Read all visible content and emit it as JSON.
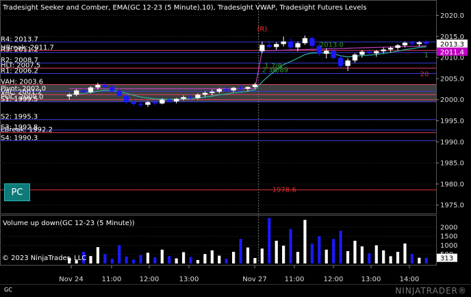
{
  "price_panel": {
    "title": "Tradesight Seeker and Comber, EMA(GC 12-23 (5 Minute),10), Tradesight VWAP, Tradesight Futures Levels",
    "ylim": [
      1973,
      2023
    ],
    "yticks": [
      1975.0,
      1980.0,
      1985.0,
      1990.0,
      1995.0,
      2000.0,
      2005.0,
      2010.0,
      2015.0,
      2020.0
    ],
    "current_price": "2013.3",
    "vwap_value": "2011.4",
    "marker_text": "(R)",
    "annotations": [
      {
        "text": "2013.0",
        "x": 0.73,
        "y": 2013.0,
        "color": "#2e9e2e"
      },
      {
        "text": "1",
        "x": 0.99,
        "y": 2010.6,
        "color": "#2e9e2e"
      },
      {
        "text": "1 7/8",
        "x": 0.57,
        "y": 2008.0,
        "color": "#2e9e2e"
      },
      {
        "text": "2 36/89",
        "x": 0.575,
        "y": 2007.0,
        "color": "#2e9e2e"
      },
      {
        "text": "1978.6",
        "x": 0.6,
        "y": 1978.6,
        "color": "#e03030"
      },
      {
        "text": "20",
        "x": 0.985,
        "y": 2006.0,
        "color": "#e03030"
      }
    ],
    "levels": [
      {
        "label": "R4: 2013.7",
        "value": 2013.7,
        "color": "#3a3ae0"
      },
      {
        "label": "HBreak: 2011.7",
        "value": 2011.7,
        "color": "#e04060"
      },
      {
        "label": "R3: 2011.2",
        "value": 2011.2,
        "color": "#3a3ae0"
      },
      {
        "label": "R2: 2008.7",
        "value": 2008.7,
        "color": "#3a3ae0"
      },
      {
        "label": "HLT: 2007.5",
        "value": 2007.5,
        "color": "#e04060"
      },
      {
        "label": "R1: 2006.2",
        "value": 2006.2,
        "color": "#3a3ae0"
      },
      {
        "label": "VAH: 2003.6",
        "value": 2003.6,
        "color": "#e04060"
      },
      {
        "label": "Pivot: 2002.0",
        "value": 2002.0,
        "color": "#3a3ae0"
      },
      {
        "label": "VAL: 2001.2",
        "value": 2001.2,
        "color": "#e04060"
      },
      {
        "label": "POC: 2000.0",
        "value": 2000.0,
        "color": "#e04060"
      },
      {
        "label": "S1: 1999.5",
        "value": 1999.5,
        "color": "#3a3ae0"
      },
      {
        "label": "S2: 1995.3",
        "value": 1995.3,
        "color": "#3a3ae0"
      },
      {
        "label": "S3: 1992.8",
        "value": 1992.8,
        "color": "#3a3ae0"
      },
      {
        "label": "LBreak: 1992.2",
        "value": 1992.2,
        "color": "#e04060"
      },
      {
        "label": "S4: 1990.3",
        "value": 1990.3,
        "color": "#3a3ae0"
      },
      {
        "label": "",
        "value": 1978.6,
        "color": "#e03030"
      }
    ]
  },
  "volume_panel": {
    "title": "Volume up down(GC 12-23 (5 Minute))",
    "ylim": [
      0,
      2600
    ],
    "yticks": [
      500,
      1000,
      1500,
      2000
    ],
    "current_volume": "313"
  },
  "x_axis": {
    "ticks": [
      "Nov 24",
      "11:00",
      "12:00",
      "13:00",
      "Nov 27",
      "11:00",
      "12:00",
      "13:00",
      "14:00"
    ]
  },
  "footer": {
    "copyright": "© 2023 NinjaTrader, LLC",
    "instrument": "GC",
    "brand": "NINJATRADER®"
  },
  "buttons": {
    "pc_label": "PC"
  },
  "colors": {
    "background": "#000000",
    "grid": "#2a2a2a",
    "up_candle": "#ffffff",
    "down_candle": "#1a1aff",
    "ema": "#2fb5a5",
    "vwap": "#c040c0",
    "value_area": "#4a4a4a",
    "current_price_box": "#ffffff",
    "vwap_box": "#c000c0"
  },
  "chart_data": {
    "type": "candlestick",
    "series": [
      {
        "name": "GC 12-23 (5 Minute)",
        "values": [
          [
            2000.8,
            2001.5,
            2000.0,
            2001.2
          ],
          [
            2001.2,
            2002.5,
            2000.8,
            2002.2
          ],
          [
            2002.2,
            2003.0,
            2001.5,
            2001.8
          ],
          [
            2001.8,
            2003.2,
            2001.5,
            2002.9
          ],
          [
            2002.9,
            2004.0,
            2002.4,
            2003.5
          ],
          [
            2003.5,
            2004.2,
            2002.8,
            2003.0
          ],
          [
            2003.0,
            2003.6,
            2001.8,
            2002.1
          ],
          [
            2002.1,
            2002.6,
            2000.4,
            2000.9
          ],
          [
            2000.9,
            2001.4,
            1999.0,
            1999.5
          ],
          [
            1999.5,
            2000.2,
            1998.5,
            1999.0
          ],
          [
            1999.0,
            1999.6,
            1998.2,
            1998.8
          ],
          [
            1998.8,
            1999.7,
            1998.3,
            1999.4
          ],
          [
            1999.4,
            2000.0,
            1998.6,
            1999.1
          ],
          [
            1999.1,
            2000.3,
            1998.9,
            2000.0
          ],
          [
            2000.0,
            2000.6,
            1999.2,
            1999.6
          ],
          [
            1999.6,
            2000.4,
            1999.1,
            2000.2
          ],
          [
            2000.2,
            2001.0,
            1999.8,
            2000.6
          ],
          [
            2000.6,
            2001.2,
            2000.0,
            2000.4
          ],
          [
            2000.4,
            2001.5,
            2000.1,
            2001.2
          ],
          [
            2001.2,
            2002.0,
            2000.7,
            2001.6
          ],
          [
            2001.6,
            2002.4,
            2001.0,
            2001.9
          ],
          [
            2001.9,
            2002.8,
            2001.5,
            2002.5
          ],
          [
            2002.5,
            2003.1,
            2001.9,
            2002.2
          ],
          [
            2002.2,
            2003.0,
            2001.8,
            2002.8
          ],
          [
            2002.8,
            2003.5,
            2002.2,
            2002.6
          ],
          [
            2002.6,
            2003.2,
            2002.0,
            2003.0
          ],
          [
            2003.0,
            2004.0,
            2002.6,
            2003.6
          ],
          [
            2011.5,
            2013.8,
            2011.0,
            2013.0
          ],
          [
            2013.0,
            2014.0,
            2012.2,
            2012.5
          ],
          [
            2012.5,
            2013.6,
            2011.8,
            2013.2
          ],
          [
            2013.2,
            2015.0,
            2012.6,
            2013.8
          ],
          [
            2013.8,
            2014.5,
            2012.0,
            2012.4
          ],
          [
            2012.4,
            2013.8,
            2011.5,
            2013.4
          ],
          [
            2013.4,
            2015.2,
            2013.0,
            2014.6
          ],
          [
            2014.6,
            2015.0,
            2012.2,
            2012.8
          ],
          [
            2012.8,
            2013.4,
            2010.4,
            2010.9
          ],
          [
            2010.9,
            2012.2,
            2009.8,
            2011.6
          ],
          [
            2011.6,
            2012.4,
            2009.5,
            2009.9
          ],
          [
            2009.9,
            2010.6,
            2007.5,
            2008.0
          ],
          [
            2008.0,
            2009.8,
            2006.8,
            2009.3
          ],
          [
            2009.3,
            2011.0,
            2008.8,
            2010.7
          ],
          [
            2010.7,
            2011.8,
            2010.0,
            2011.4
          ],
          [
            2011.4,
            2012.0,
            2010.5,
            2011.0
          ],
          [
            2011.0,
            2011.8,
            2010.2,
            2011.5
          ],
          [
            2011.5,
            2012.4,
            2011.0,
            2011.9
          ],
          [
            2011.9,
            2012.6,
            2011.2,
            2012.3
          ],
          [
            2012.3,
            2013.2,
            2011.8,
            2012.9
          ],
          [
            2012.9,
            2013.8,
            2012.4,
            2013.5
          ],
          [
            2013.5,
            2014.0,
            2012.9,
            2013.2
          ],
          [
            2013.2,
            2013.9,
            2012.6,
            2013.6
          ],
          [
            2013.6,
            2014.2,
            2013.0,
            2013.3
          ]
        ]
      }
    ],
    "volume": [
      320,
      180,
      650,
      410,
      900,
      520,
      260,
      1000,
      380,
      210,
      460,
      590,
      340,
      760,
      410,
      280,
      620,
      350,
      190,
      520,
      720,
      430,
      260,
      640,
      1350,
      880,
      300,
      820,
      2500,
      1250,
      980,
      1900,
      640,
      2400,
      1100,
      1500,
      760,
      1350,
      1800,
      680,
      1250,
      940,
      560,
      1000,
      720,
      400,
      640,
      1100,
      520,
      313,
      313
    ],
    "ylim": [
      1973,
      2023
    ]
  }
}
